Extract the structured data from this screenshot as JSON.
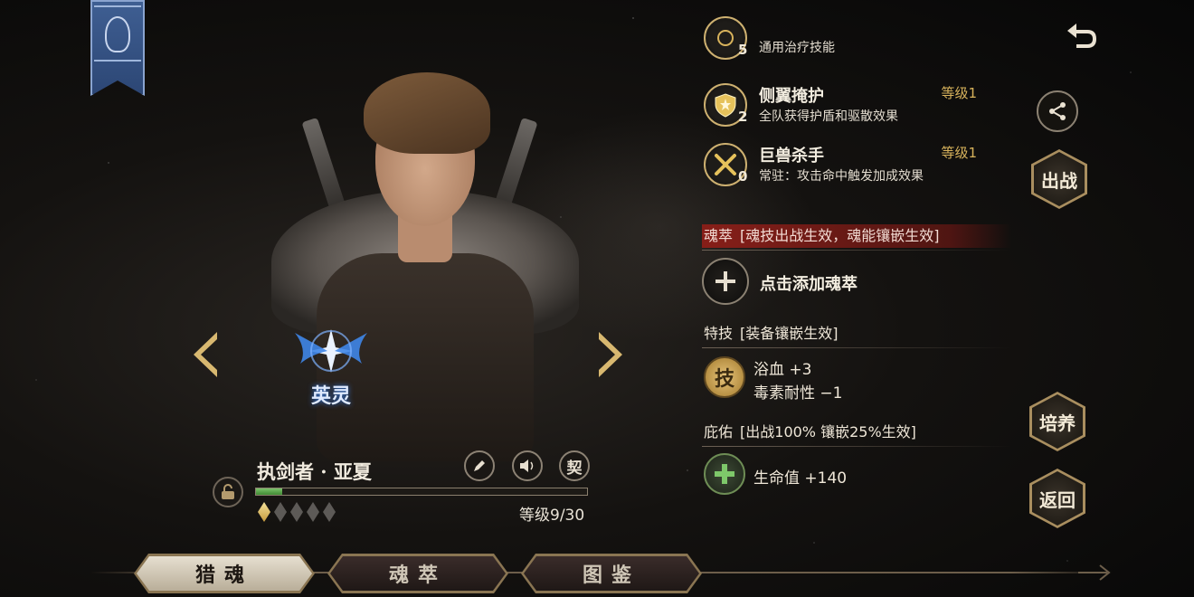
{
  "character": {
    "name": "执剑者 · 亚夏",
    "soul_label": "英灵",
    "level_text": "等级9/30",
    "exp_fraction": 0.08,
    "stars_total": 5,
    "stars_filled": 1,
    "pact_label": "契"
  },
  "skills": [
    {
      "name": "",
      "desc": "通用治疗技能",
      "count": "5",
      "level": "",
      "icon": "heal-icon"
    },
    {
      "name": "侧翼掩护",
      "desc": "全队获得护盾和驱散效果",
      "count": "2",
      "level": "等级1",
      "icon": "shield-icon"
    },
    {
      "name": "巨兽杀手",
      "desc": "常驻：攻击命中触发加成效果",
      "count": "0",
      "level": "等级1",
      "icon": "crossed-swords-icon"
    }
  ],
  "soul_essence": {
    "title": "魂萃",
    "note": "[魂技出战生效，魂能镶嵌生效]",
    "add_label": "点击添加魂萃"
  },
  "special": {
    "title": "特技",
    "note": "[装备镶嵌生效]",
    "icon_char": "技",
    "stats": [
      "浴血  +3",
      "毒素耐性  −1"
    ]
  },
  "blessing": {
    "title": "庇佑",
    "note": "[出战100% 镶嵌25%生效]",
    "stats": [
      "生命值 +140"
    ]
  },
  "side_buttons": {
    "deploy": "出战",
    "train": "培养",
    "back": "返回"
  },
  "tabs": [
    {
      "label": "猎魂",
      "active": true
    },
    {
      "label": "魂萃",
      "active": false
    },
    {
      "label": "图鉴",
      "active": false
    }
  ],
  "colors": {
    "accent_gold": "#d8b35c",
    "section_red": "#8c1e18",
    "exp_green": "#5aa84a"
  }
}
